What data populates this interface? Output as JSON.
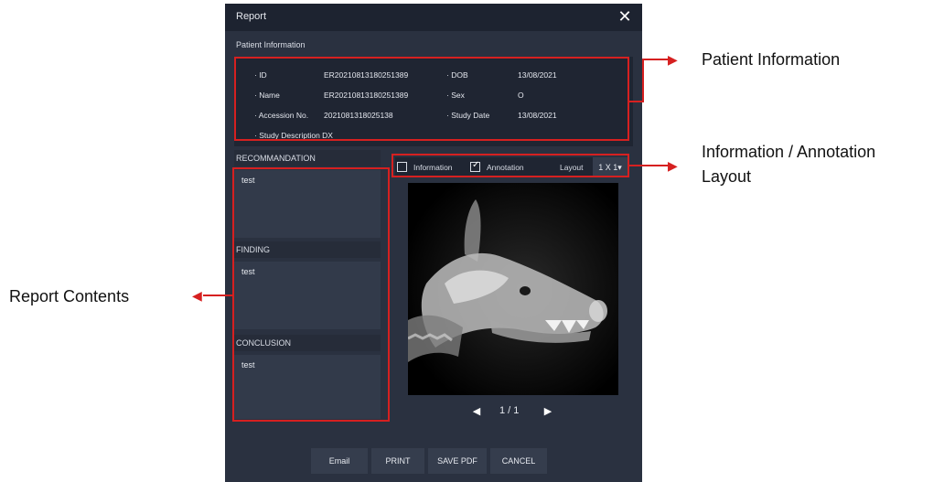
{
  "dialog": {
    "title": "Report",
    "close_icon": "close-icon"
  },
  "patient_info": {
    "section_label": "Patient Information",
    "id_label": "· ID",
    "id_value": "ER20210813180251389",
    "name_label": "· Name",
    "name_value": "ER20210813180251389",
    "accession_label": "· Accession No.",
    "accession_value": "2021081318025138",
    "study_description": "· Study Description DX",
    "dob_label": "· DOB",
    "dob_value": "13/08/2021",
    "sex_label": "· Sex",
    "sex_value": "O",
    "study_date_label": "· Study Date",
    "study_date_value": "13/08/2021"
  },
  "report": {
    "recommendation_label": "RECOMMANDATION",
    "recommendation_text": "test",
    "finding_label": "FINDING",
    "finding_text": "test",
    "conclusion_label": "CONCLUSION",
    "conclusion_text": "test"
  },
  "toolbar": {
    "information_label": "Information",
    "information_checked": false,
    "annotation_label": "Annotation",
    "annotation_checked": true,
    "layout_label": "Layout",
    "layout_value": "1 X 1"
  },
  "pager": {
    "text": "1 / 1",
    "prev_icon": "triangle-left-icon",
    "next_icon": "triangle-right-icon"
  },
  "buttons": {
    "email": "Email",
    "print": "PRINT",
    "save_pdf": "SAVE PDF",
    "cancel": "CANCEL"
  },
  "callouts": {
    "patient_information": "Patient Information",
    "info_annotation_line1": "Information / Annotation",
    "info_annotation_line2": "Layout",
    "report_contents": "Report Contents"
  },
  "colors": {
    "dialog_bg": "#2a3140",
    "titlebar_bg": "#1d2330",
    "highlight_red": "#d62020"
  }
}
